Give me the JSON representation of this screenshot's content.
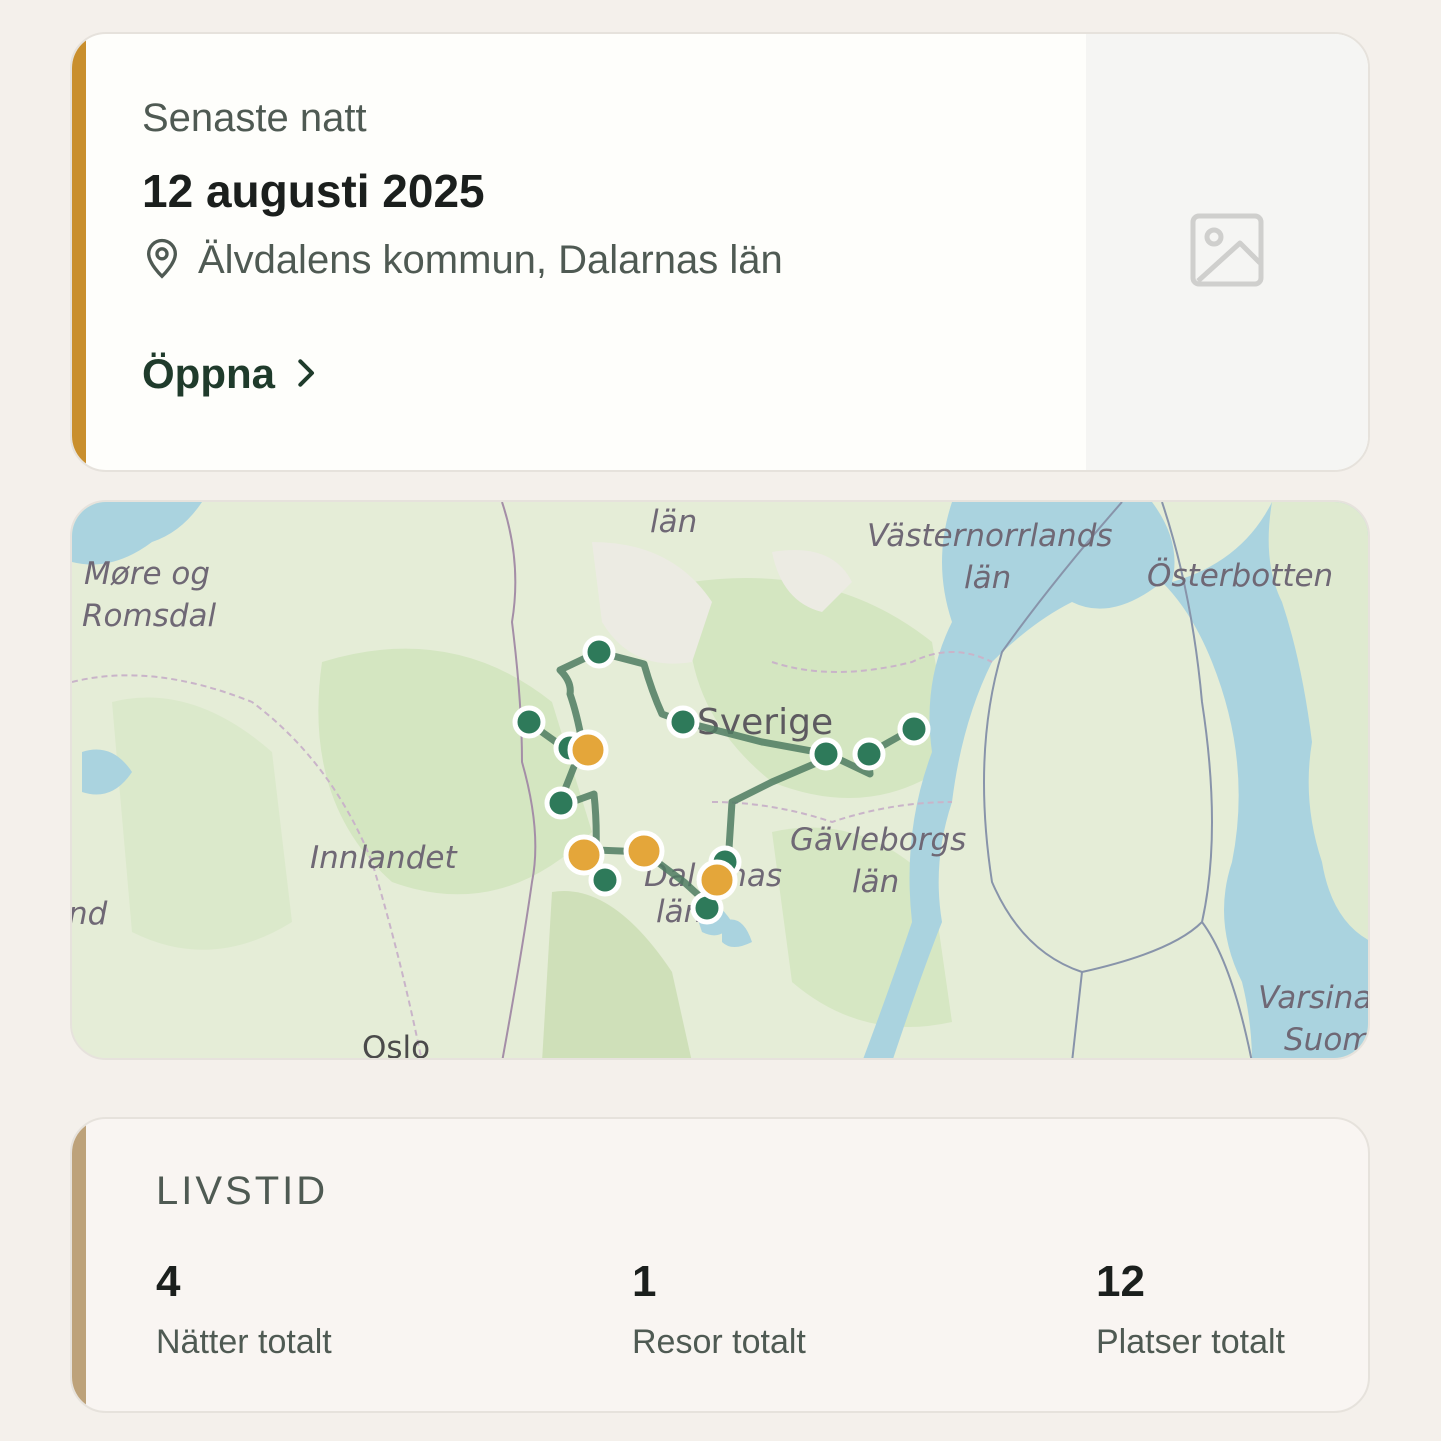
{
  "last_night": {
    "eyebrow": "Senaste natt",
    "date": "12 augusti 2025",
    "location": "Älvdalens kommun, Dalarnas län",
    "open_label": "Öppna",
    "location_icon": "map-pin-icon",
    "thumbnail_icon": "image-placeholder-icon"
  },
  "map": {
    "labels": {
      "mr": "Møre og",
      "romsdal": "Romsdal",
      "lan_top": "län",
      "vasternorr": "Västernorrlands",
      "lan_vn": "län",
      "osterbotten": "Österbotten",
      "sverige": "Sverige",
      "innlandet": "Innlandet",
      "gavleborgs": "Gävleborgs",
      "lan_g": "län",
      "dalarnas": "Dalarnas",
      "lan_d": "län",
      "oslo": "Oslo",
      "varsinais": "Varsinais",
      "suomi": "Suomi",
      "edge": "nd"
    },
    "colors": {
      "route": "#4f7b62",
      "stop": "#2e7a5a",
      "night": "#e4a63a"
    }
  },
  "lifetime": {
    "title": "LIVSTID",
    "stats": [
      {
        "value": "4",
        "label": "Nätter totalt"
      },
      {
        "value": "1",
        "label": "Resor totalt"
      },
      {
        "value": "12",
        "label": "Platser totalt"
      }
    ]
  }
}
